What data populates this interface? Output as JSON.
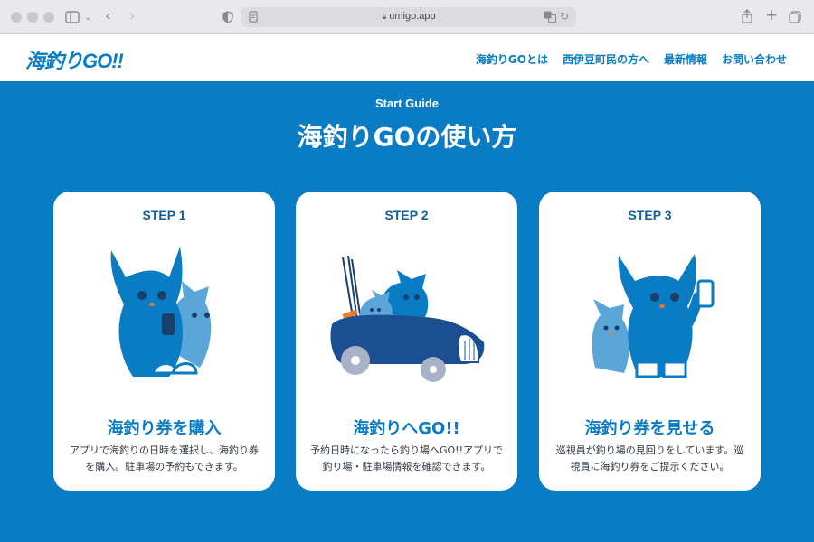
{
  "browser": {
    "url": "umigo.app",
    "icons": [
      "sidebar-icon",
      "chevron-down-icon",
      "back-icon",
      "forward-icon",
      "shield-icon",
      "page-icon",
      "lock-icon",
      "translate-icon",
      "reload-icon",
      "share-icon",
      "plus-icon",
      "tabs-icon"
    ]
  },
  "header": {
    "logo": "海釣りGO!!",
    "nav": [
      {
        "label": "海釣りGOとは"
      },
      {
        "label": "西伊豆町民の方へ"
      },
      {
        "label": "最新情報"
      },
      {
        "label": "お問い合わせ"
      }
    ]
  },
  "hero": {
    "eyebrow": "Start Guide",
    "title": "海釣りGOの使い方"
  },
  "steps": [
    {
      "step": "STEP 1",
      "title": "海釣り券を購入",
      "desc": "アプリで海釣りの日時を選択し、海釣り券を購入。駐車場の予約もできます。",
      "illustration": "cats-with-smartphone"
    },
    {
      "step": "STEP 2",
      "title": "海釣りへGO!!",
      "desc": "予約日時になったら釣り場へGO!!アプリで釣り場・駐車場情報を確認できます。",
      "illustration": "cats-driving-car"
    },
    {
      "step": "STEP 3",
      "title": "海釣り券を見せる",
      "desc": "巡視員が釣り場の見回りをしています。巡視員に海釣り券をご提示ください。",
      "illustration": "cats-showing-phone"
    }
  ],
  "colors": {
    "brand_blue": "#0a7cc4",
    "dark_blue": "#0f5e9e",
    "light_blue": "#5aa6d8",
    "accent_orange": "#f07a2a"
  }
}
